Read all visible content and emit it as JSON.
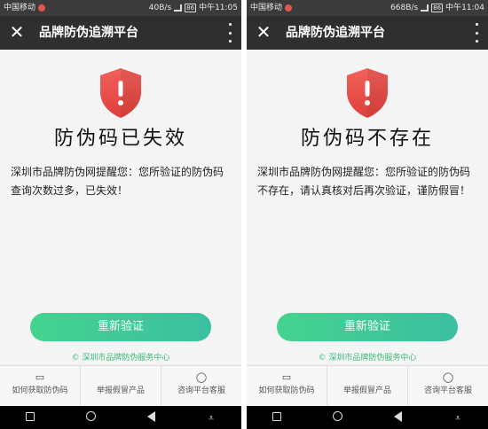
{
  "screens": [
    {
      "status": {
        "carrier": "中国移动",
        "speed": "40B/s",
        "battery": "86",
        "time": "中午11:05"
      },
      "header": {
        "title": "品牌防伪追溯平台"
      },
      "main": {
        "headline": "防伪码已失效",
        "message": "深圳市品牌防伪网提醒您：您所验证的防伪码查询次数过多，已失效！",
        "retry_label": "重新验证",
        "footer_note": "© 深圳市品牌防伪服务中心"
      },
      "tabs": [
        {
          "label": "如何获取防伪码",
          "icon": "wallet-icon"
        },
        {
          "label": "举报假冒产品",
          "icon": "report-icon"
        },
        {
          "label": "咨询平台客服",
          "icon": "chat-bubble-icon"
        }
      ]
    },
    {
      "status": {
        "carrier": "中国移动",
        "speed": "668B/s",
        "battery": "86",
        "time": "中午11:04"
      },
      "header": {
        "title": "品牌防伪追溯平台"
      },
      "main": {
        "headline": "防伪码不存在",
        "message": "深圳市品牌防伪网提醒您：您所验证的防伪码不存在，请认真核对后再次验证，谨防假冒！",
        "retry_label": "重新验证",
        "footer_note": "© 深圳市品牌防伪服务中心"
      },
      "tabs": [
        {
          "label": "如何获取防伪码",
          "icon": "wallet-icon"
        },
        {
          "label": "举报假冒产品",
          "icon": "report-icon"
        },
        {
          "label": "咨询平台客服",
          "icon": "chat-bubble-icon"
        }
      ]
    }
  ],
  "colors": {
    "shield_top": "#f2605a",
    "shield_bottom": "#e0403c",
    "button_start": "#45d38f",
    "button_end": "#3cbfa0",
    "titlebar": "#2f2f2f"
  }
}
